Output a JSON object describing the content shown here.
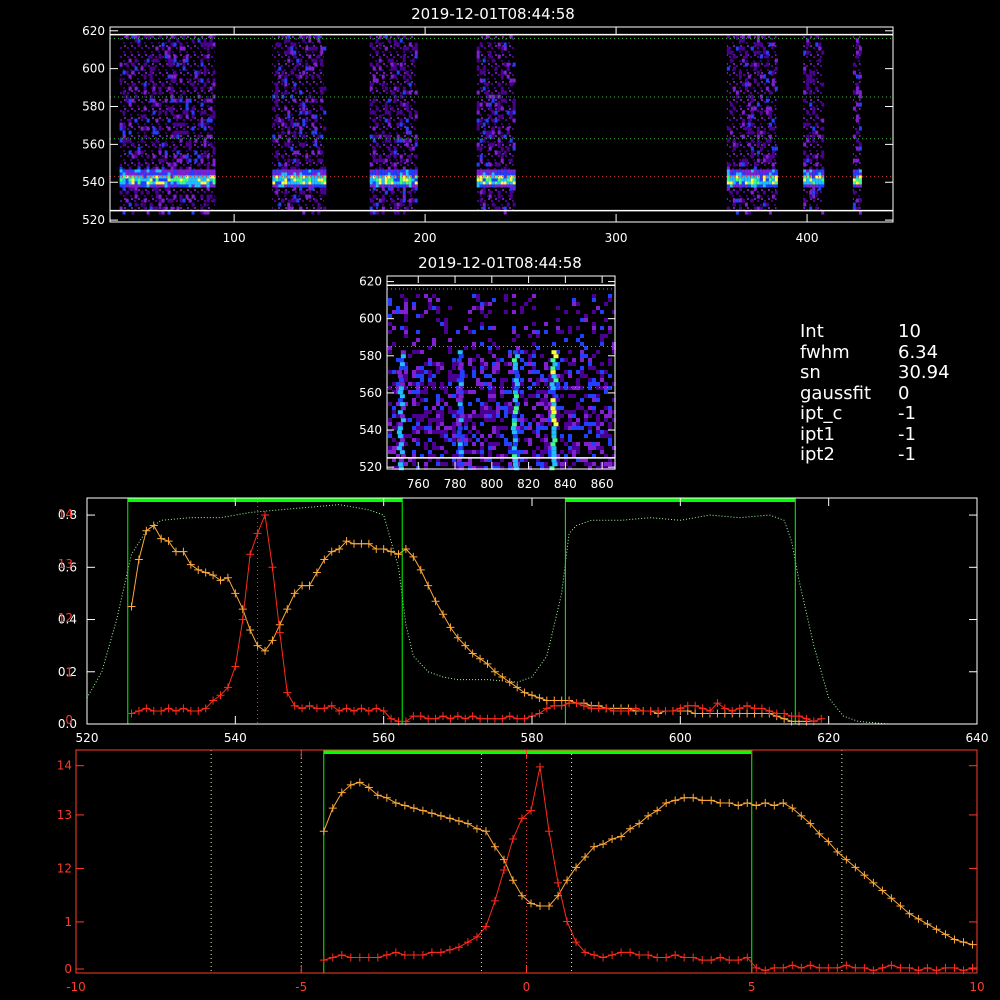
{
  "titles": {
    "top": "2019-12-01T08:44:58",
    "mid": "2019-12-01T08:44:58"
  },
  "info": [
    {
      "key": "Int",
      "value": "10"
    },
    {
      "key": "fwhm",
      "value": "6.34"
    },
    {
      "key": "sn",
      "value": "30.94"
    },
    {
      "key": "gaussfit",
      "value": "0"
    },
    {
      "key": "ipt_c",
      "value": "-1"
    },
    {
      "key": "ipt1",
      "value": "-1"
    },
    {
      "key": "ipt2",
      "value": "-1"
    }
  ],
  "colors": {
    "background": "#000000",
    "axes": "#ffffff",
    "red_series": "#ff2a1a",
    "orange_series": "#ffa93a",
    "green_bar": "#00ff00",
    "green_dotted": "#9cff9c"
  },
  "chart_data": [
    {
      "type": "heatmap",
      "id": "top-spectrogram",
      "title": "2019-12-01T08:44:58",
      "xlim": [
        35,
        445
      ],
      "ylim": [
        519,
        622
      ],
      "xticks": [
        100,
        200,
        300,
        400
      ],
      "yticks": [
        520,
        540,
        560,
        580,
        600,
        620
      ],
      "bright_band_y": 542,
      "segments": [
        [
          40,
          90
        ],
        [
          120,
          147
        ],
        [
          171,
          195
        ],
        [
          227,
          247
        ],
        [
          358,
          384
        ],
        [
          398,
          408
        ],
        [
          424,
          428
        ]
      ],
      "hlines_solid": [
        525,
        618
      ],
      "hlines_dotted": [
        543,
        563,
        585,
        616
      ]
    },
    {
      "type": "heatmap",
      "id": "mid-spectrogram",
      "title": "2019-12-01T08:44:58",
      "xlim": [
        743,
        867
      ],
      "ylim": [
        519,
        623
      ],
      "xticks": [
        760,
        780,
        800,
        820,
        840,
        860
      ],
      "yticks": [
        520,
        540,
        560,
        580,
        600,
        620
      ],
      "bright_columns_x": [
        750,
        782,
        812,
        833
      ],
      "hlines_solid": [
        525,
        618
      ],
      "hlines_dotted": [
        563,
        585,
        616
      ]
    },
    {
      "type": "line",
      "id": "panel-1",
      "xlim": [
        520,
        640
      ],
      "ylim_left": [
        0,
        0.85
      ],
      "xticks": [
        520,
        540,
        560,
        580,
        600,
        620,
        640
      ],
      "yticks_left": [
        "0.0",
        "0.2",
        "0.4",
        "0.6",
        "0.8"
      ],
      "yticks_left_values": [
        0.0,
        0.2,
        0.4,
        0.6,
        0.8
      ],
      "yticks_red": [
        "0",
        "1",
        "12",
        "13",
        "14"
      ],
      "yticks_red_pos": [
        0.0,
        0.22,
        0.47,
        0.72,
        0.95
      ],
      "green_segments": [
        [
          525.5,
          562.5
        ],
        [
          584.5,
          615.5
        ]
      ],
      "vline_dotted": 543,
      "series": [
        {
          "color": "orange",
          "x": [
            526,
            527,
            528,
            529,
            530,
            531,
            532,
            533,
            534,
            535,
            536,
            537,
            538,
            539,
            540,
            541,
            542,
            543,
            544,
            545,
            546,
            547,
            548,
            549,
            550,
            551,
            552,
            553,
            554,
            555,
            556,
            557,
            558,
            559,
            560,
            561,
            562,
            563,
            564,
            565,
            566,
            567,
            568,
            569,
            570,
            571,
            572,
            573,
            574,
            575,
            576,
            577,
            578,
            579,
            580,
            581,
            582,
            583,
            584,
            585,
            586,
            587,
            588,
            589,
            590,
            591,
            592,
            593,
            594,
            595,
            596,
            597,
            598,
            599,
            600,
            601,
            602,
            603,
            604,
            605,
            606,
            607,
            608,
            609,
            610,
            611,
            612,
            613,
            614,
            615,
            616,
            617
          ],
          "y": [
            0.45,
            0.63,
            0.74,
            0.76,
            0.71,
            0.7,
            0.66,
            0.66,
            0.61,
            0.59,
            0.58,
            0.57,
            0.55,
            0.56,
            0.5,
            0.44,
            0.36,
            0.3,
            0.28,
            0.32,
            0.38,
            0.44,
            0.5,
            0.53,
            0.53,
            0.58,
            0.63,
            0.66,
            0.67,
            0.7,
            0.69,
            0.69,
            0.69,
            0.67,
            0.67,
            0.66,
            0.65,
            0.67,
            0.64,
            0.59,
            0.53,
            0.47,
            0.42,
            0.37,
            0.33,
            0.3,
            0.27,
            0.25,
            0.23,
            0.2,
            0.18,
            0.16,
            0.14,
            0.12,
            0.11,
            0.1,
            0.09,
            0.09,
            0.09,
            0.09,
            0.08,
            0.08,
            0.07,
            0.07,
            0.06,
            0.06,
            0.06,
            0.06,
            0.05,
            0.05,
            0.05,
            0.04,
            0.05,
            0.05,
            0.05,
            0.05,
            0.04,
            0.04,
            0.04,
            0.04,
            0.04,
            0.04,
            0.04,
            0.04,
            0.04,
            0.04,
            0.04,
            0.03,
            0.02,
            0.01,
            0.01,
            0.01
          ]
        },
        {
          "color": "red",
          "x": [
            526,
            527,
            528,
            529,
            530,
            531,
            532,
            533,
            534,
            535,
            536,
            537,
            538,
            539,
            540,
            541,
            542,
            543,
            544,
            545,
            546,
            547,
            548,
            549,
            550,
            551,
            552,
            553,
            554,
            555,
            556,
            557,
            558,
            559,
            560,
            561,
            562,
            563,
            564,
            565,
            566,
            567,
            568,
            569,
            570,
            571,
            572,
            573,
            574,
            575,
            576,
            577,
            578,
            579,
            580,
            581,
            582,
            583,
            584,
            585,
            586,
            587,
            588,
            589,
            590,
            591,
            592,
            593,
            594,
            595,
            596,
            597,
            598,
            599,
            600,
            601,
            602,
            603,
            604,
            605,
            606,
            607,
            608,
            609,
            610,
            611,
            612,
            613,
            614,
            615,
            616,
            617,
            618,
            619
          ],
          "y": [
            0.04,
            0.05,
            0.06,
            0.05,
            0.05,
            0.06,
            0.05,
            0.06,
            0.05,
            0.05,
            0.06,
            0.09,
            0.11,
            0.14,
            0.22,
            0.4,
            0.65,
            0.73,
            0.8,
            0.6,
            0.35,
            0.12,
            0.07,
            0.06,
            0.07,
            0.06,
            0.06,
            0.07,
            0.05,
            0.06,
            0.05,
            0.06,
            0.05,
            0.06,
            0.05,
            0.02,
            0.01,
            0.01,
            0.03,
            0.03,
            0.02,
            0.02,
            0.03,
            0.02,
            0.03,
            0.02,
            0.03,
            0.02,
            0.02,
            0.02,
            0.02,
            0.03,
            0.02,
            0.02,
            0.03,
            0.04,
            0.06,
            0.07,
            0.07,
            0.08,
            0.08,
            0.07,
            0.06,
            0.06,
            0.06,
            0.05,
            0.05,
            0.05,
            0.06,
            0.05,
            0.05,
            0.05,
            0.05,
            0.05,
            0.06,
            0.07,
            0.07,
            0.06,
            0.05,
            0.08,
            0.06,
            0.05,
            0.06,
            0.07,
            0.06,
            0.06,
            0.05,
            0.04,
            0.04,
            0.03,
            0.03,
            0.02,
            0.01,
            0.02
          ]
        },
        {
          "color": "green-dotted",
          "x": [
            520,
            522,
            524,
            526,
            528,
            530,
            534,
            538,
            542,
            546,
            550,
            554,
            556,
            558,
            560,
            562,
            563,
            564,
            566,
            568,
            570,
            574,
            578,
            580,
            582,
            584,
            585,
            586,
            588,
            592,
            596,
            600,
            604,
            608,
            612,
            614,
            615,
            616,
            618,
            620,
            622,
            624,
            628,
            632,
            636,
            640
          ],
          "y": [
            0.1,
            0.2,
            0.4,
            0.65,
            0.74,
            0.78,
            0.79,
            0.79,
            0.81,
            0.82,
            0.83,
            0.84,
            0.83,
            0.82,
            0.8,
            0.6,
            0.38,
            0.26,
            0.2,
            0.18,
            0.17,
            0.17,
            0.16,
            0.18,
            0.26,
            0.5,
            0.73,
            0.76,
            0.78,
            0.78,
            0.79,
            0.78,
            0.8,
            0.79,
            0.8,
            0.78,
            0.7,
            0.55,
            0.3,
            0.1,
            0.03,
            0.01,
            0.0,
            0.0,
            0.0,
            0.0
          ]
        }
      ]
    },
    {
      "type": "line",
      "id": "panel-2",
      "xlim": [
        -10,
        10
      ],
      "xticks": [
        "-10",
        "-5",
        "0",
        "5",
        "10"
      ],
      "xticks_values": [
        -10,
        -5,
        0,
        5,
        10
      ],
      "ylim_left": [
        0,
        0.85
      ],
      "yticks_red": [
        "0",
        "1",
        "12",
        "13",
        "14"
      ],
      "yticks_red_pos": [
        0.0,
        0.22,
        0.47,
        0.72,
        0.95
      ],
      "green_segment": [
        -4.5,
        5
      ],
      "vlines_dotted": [
        -7,
        -5,
        -1,
        0,
        1,
        7
      ],
      "series": [
        {
          "color": "orange",
          "x": [
            -4.5,
            -4.3,
            -4.1,
            -3.9,
            -3.7,
            -3.5,
            -3.3,
            -3.1,
            -2.9,
            -2.7,
            -2.5,
            -2.3,
            -2.1,
            -1.9,
            -1.7,
            -1.5,
            -1.3,
            -1.1,
            -0.9,
            -0.7,
            -0.5,
            -0.3,
            -0.1,
            0.1,
            0.3,
            0.5,
            0.7,
            0.9,
            1.1,
            1.3,
            1.5,
            1.7,
            1.9,
            2.1,
            2.3,
            2.5,
            2.7,
            2.9,
            3.1,
            3.3,
            3.5,
            3.7,
            3.9,
            4.1,
            4.3,
            4.5,
            4.7,
            4.9,
            5.1,
            5.3,
            5.5,
            5.7,
            5.9,
            6.1,
            6.3,
            6.5,
            6.7,
            6.9,
            7.1,
            7.3,
            7.5,
            7.7,
            7.9,
            8.1,
            8.3,
            8.5,
            8.7,
            8.9,
            9.1,
            9.3,
            9.5,
            9.7,
            9.9
          ],
          "y": [
            0.55,
            0.64,
            0.7,
            0.73,
            0.74,
            0.72,
            0.69,
            0.68,
            0.66,
            0.65,
            0.64,
            0.63,
            0.62,
            0.61,
            0.6,
            0.59,
            0.58,
            0.56,
            0.55,
            0.49,
            0.44,
            0.36,
            0.3,
            0.27,
            0.26,
            0.26,
            0.3,
            0.36,
            0.41,
            0.45,
            0.49,
            0.5,
            0.52,
            0.53,
            0.56,
            0.58,
            0.61,
            0.63,
            0.66,
            0.67,
            0.68,
            0.68,
            0.67,
            0.67,
            0.66,
            0.66,
            0.65,
            0.66,
            0.65,
            0.66,
            0.65,
            0.66,
            0.64,
            0.61,
            0.58,
            0.54,
            0.51,
            0.47,
            0.44,
            0.41,
            0.38,
            0.35,
            0.32,
            0.29,
            0.26,
            0.23,
            0.21,
            0.19,
            0.17,
            0.15,
            0.13,
            0.12,
            0.11
          ]
        },
        {
          "color": "red",
          "x": [
            -4.5,
            -4.3,
            -4.1,
            -3.9,
            -3.7,
            -3.5,
            -3.3,
            -3.1,
            -2.9,
            -2.7,
            -2.5,
            -2.3,
            -2.1,
            -1.9,
            -1.7,
            -1.5,
            -1.3,
            -1.1,
            -0.9,
            -0.7,
            -0.5,
            -0.3,
            -0.1,
            0.1,
            0.3,
            0.5,
            0.7,
            0.9,
            1.1,
            1.3,
            1.5,
            1.7,
            1.9,
            2.1,
            2.3,
            2.5,
            2.7,
            2.9,
            3.1,
            3.3,
            3.5,
            3.7,
            3.9,
            4.1,
            4.3,
            4.5,
            4.7,
            4.9,
            5.1,
            5.3,
            5.5,
            5.7,
            5.9,
            6.1,
            6.3,
            6.5,
            6.7,
            6.9,
            7.1,
            7.3,
            7.5,
            7.7,
            7.9,
            8.1,
            8.3,
            8.5,
            8.7,
            8.9,
            9.1,
            9.3,
            9.5,
            9.7,
            9.9
          ],
          "y": [
            0.05,
            0.06,
            0.07,
            0.06,
            0.06,
            0.06,
            0.06,
            0.07,
            0.08,
            0.07,
            0.07,
            0.07,
            0.08,
            0.08,
            0.09,
            0.1,
            0.12,
            0.14,
            0.18,
            0.28,
            0.4,
            0.52,
            0.6,
            0.63,
            0.8,
            0.55,
            0.35,
            0.2,
            0.12,
            0.08,
            0.07,
            0.06,
            0.07,
            0.08,
            0.08,
            0.07,
            0.07,
            0.06,
            0.06,
            0.07,
            0.06,
            0.06,
            0.05,
            0.05,
            0.06,
            0.05,
            0.05,
            0.06,
            0.02,
            0.01,
            0.02,
            0.02,
            0.03,
            0.02,
            0.03,
            0.02,
            0.02,
            0.02,
            0.03,
            0.02,
            0.02,
            0.01,
            0.02,
            0.03,
            0.02,
            0.02,
            0.01,
            0.02,
            0.01,
            0.02,
            0.02,
            0.01,
            0.02
          ]
        }
      ]
    }
  ]
}
